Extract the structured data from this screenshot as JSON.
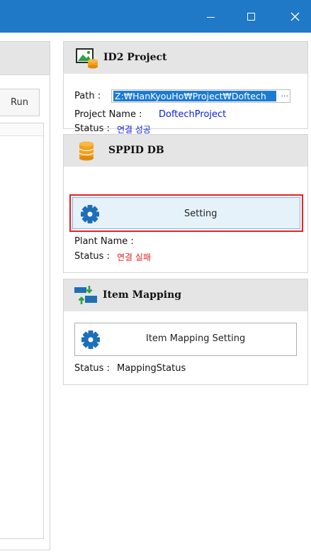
{
  "window": {
    "minimize_glyph": "—",
    "maximize_glyph": "☐",
    "close_glyph": "✕"
  },
  "left_panel": {
    "run_label": "Run"
  },
  "id2_project": {
    "title": "ID2 Project",
    "icon": "image-database-icon",
    "path_label": "Path :",
    "path_value": "Z:₩HanKyouHo₩Project₩Doftech",
    "browse_label": "···",
    "project_name_label": "Project Name :",
    "project_name_value": "DoftechProject",
    "status_label": "Status :",
    "status_value": "연결 성공"
  },
  "sppid_db": {
    "title": "SPPID DB",
    "icon": "database-icon",
    "setting_label": "Setting",
    "plant_name_label": "Plant Name :",
    "plant_name_value": "",
    "status_label": "Status :",
    "status_value": "연결 실패"
  },
  "item_mapping": {
    "title": "Item Mapping",
    "icon": "mapping-arrows-icon",
    "setting_label": "Item Mapping Setting",
    "status_label": "Status :",
    "status_value": "MappingStatus"
  },
  "colors": {
    "titlebar": "#1f79c7",
    "accent_blue": "#0b1fd8",
    "error_red": "#e32222",
    "highlight_border": "#e81e25"
  }
}
